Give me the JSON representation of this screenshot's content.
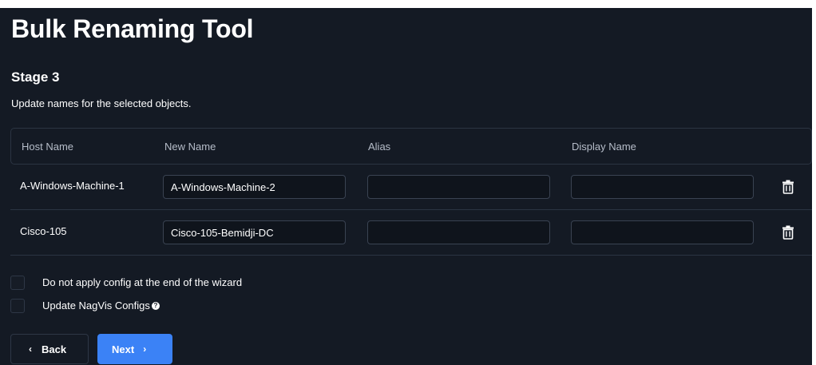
{
  "app": {
    "title": "Bulk Renaming Tool"
  },
  "stage": {
    "title": "Stage 3",
    "description": "Update names for the selected objects."
  },
  "table": {
    "headers": {
      "host_name": "Host Name",
      "new_name": "New Name",
      "alias": "Alias",
      "display_name": "Display Name"
    },
    "rows": [
      {
        "host_name": "A-Windows-Machine-1",
        "new_name": "A-Windows-Machine-2",
        "alias": "",
        "display_name": ""
      },
      {
        "host_name": "Cisco-105",
        "new_name": "Cisco-105-Bemidji-DC",
        "alias": "",
        "display_name": ""
      }
    ]
  },
  "options": {
    "no_apply_config": {
      "label": "Do not apply config at the end of the wizard",
      "checked": false
    },
    "update_nagvis": {
      "label": "Update NagVis Configs",
      "checked": false,
      "help_icon": "question-circle-icon"
    }
  },
  "buttons": {
    "back_label": "Back",
    "back_icon": "chevron-left-icon",
    "next_label": "Next",
    "next_icon": "chevron-right-icon"
  },
  "colors": {
    "background": "#141a24",
    "accent": "#3b82f6",
    "border": "#2b3442"
  }
}
